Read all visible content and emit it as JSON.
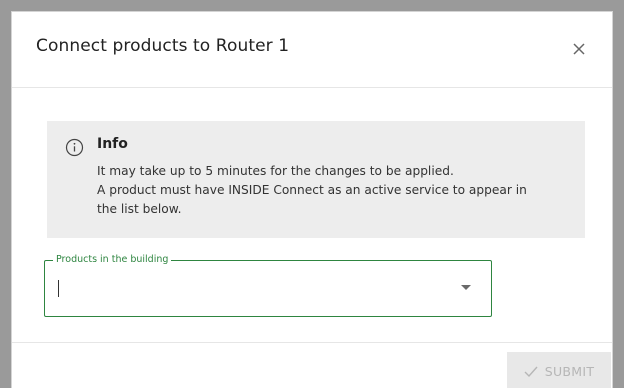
{
  "dialog": {
    "title": "Connect products to Router 1"
  },
  "info": {
    "icon": "info-circle-icon",
    "title": "Info",
    "lines": [
      "It may take up to 5 minutes for the changes to be applied.",
      "A product must have INSIDE Connect as an active service to appear in",
      "the list below."
    ]
  },
  "products_field": {
    "label": "Products in the building",
    "value": "",
    "accent_color": "#2e8540"
  },
  "footer": {
    "submit_label": "SUBMIT",
    "submit_icon": "checkmark-icon",
    "submit_disabled": true
  },
  "colors": {
    "backdrop": "#9a9a9a",
    "info_bg": "#ededed",
    "focus_green": "#2e8540",
    "disabled_button_bg": "#e8e8e8",
    "disabled_button_text": "#b6b6b6"
  }
}
